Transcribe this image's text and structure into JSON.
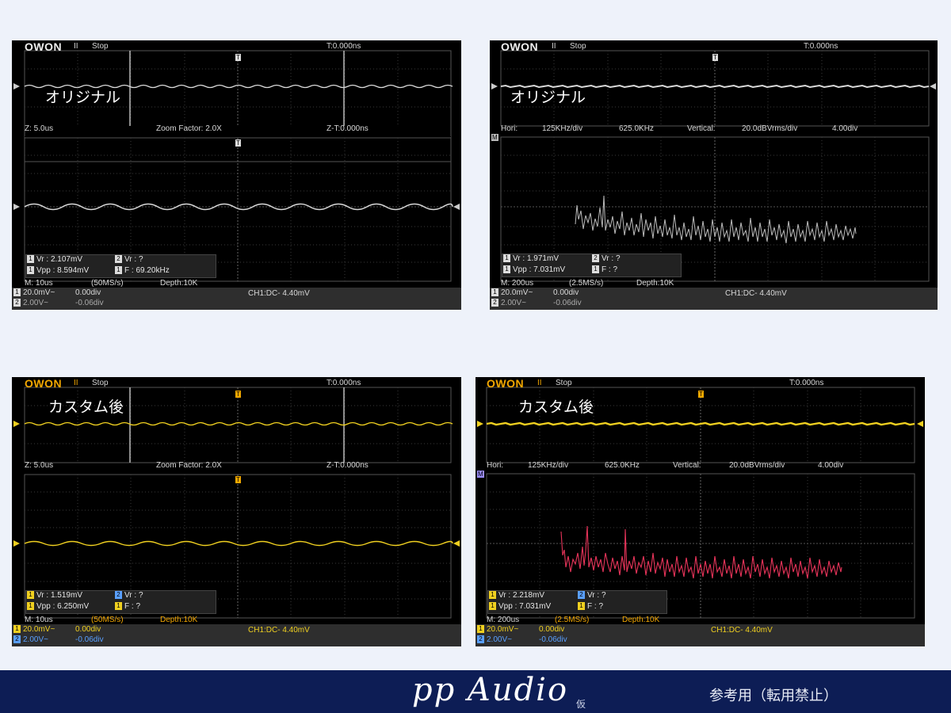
{
  "common": {
    "logo": "OWON",
    "pause": "II",
    "state": "Stop",
    "trigger_time": "T:0.000ns",
    "trig_marker": "T",
    "ch_marker": "1",
    "math_marker": "M",
    "z_label": "Z: 5.0us",
    "zoom_factor": "Zoom Factor: 2.0X",
    "zt_label": "Z-T:0.000ns",
    "hori_label": "Hori:",
    "hori_div": "125KHz/div",
    "hori_center": "625.0KHz",
    "vert_label": "Vertical:",
    "vert_div": "20.0dBVrms/div",
    "vert_offset": "4.00div",
    "ch1_scale": "20.0mV~",
    "ch1_offset": "0.00div",
    "ch2_scale": "2.00V~",
    "ch2_offset": "-0.06div",
    "trigger_info": "CH1:DC-  4.40mV",
    "depth": "Depth:10K",
    "m_10us": "M: 10us",
    "rate_50": "(50MS/s)",
    "m_200us": "M: 200us",
    "rate_2_5": "(2.5MS/s)",
    "vr2": "Vr :    ?",
    "f_q": "F :    ?"
  },
  "panels": [
    {
      "label": "オリジナル",
      "vr1": "Vr : 2.107mV",
      "vpp": "Vpp : 8.594mV",
      "freq": "F : 69.20kHz"
    },
    {
      "label": "オリジナル",
      "vr1": "Vr : 1.971mV",
      "vpp": "Vpp : 7.031mV",
      "freq": "F :    ?"
    },
    {
      "label": "カスタム後",
      "vr1": "Vr : 1.519mV",
      "vpp": "Vpp : 6.250mV",
      "freq": "F :    ?"
    },
    {
      "label": "カスタム後",
      "vr1": "Vr : 2.218mV",
      "vpp": "Vpp : 7.031mV",
      "freq": "F :    ?"
    }
  ],
  "colors": {
    "original_trace": "#d8d8d8",
    "custom_trace": "#f0d020",
    "custom_fft": "#e8345a",
    "original_fft": "#bdbdbd",
    "logo": "#f0f0f0",
    "logo_custom": "#f4a800",
    "footer_bg": "#0d1d55"
  },
  "footer": {
    "brand": "pp Audio",
    "kari": "仮",
    "notice": "参考用（転用禁止）"
  }
}
